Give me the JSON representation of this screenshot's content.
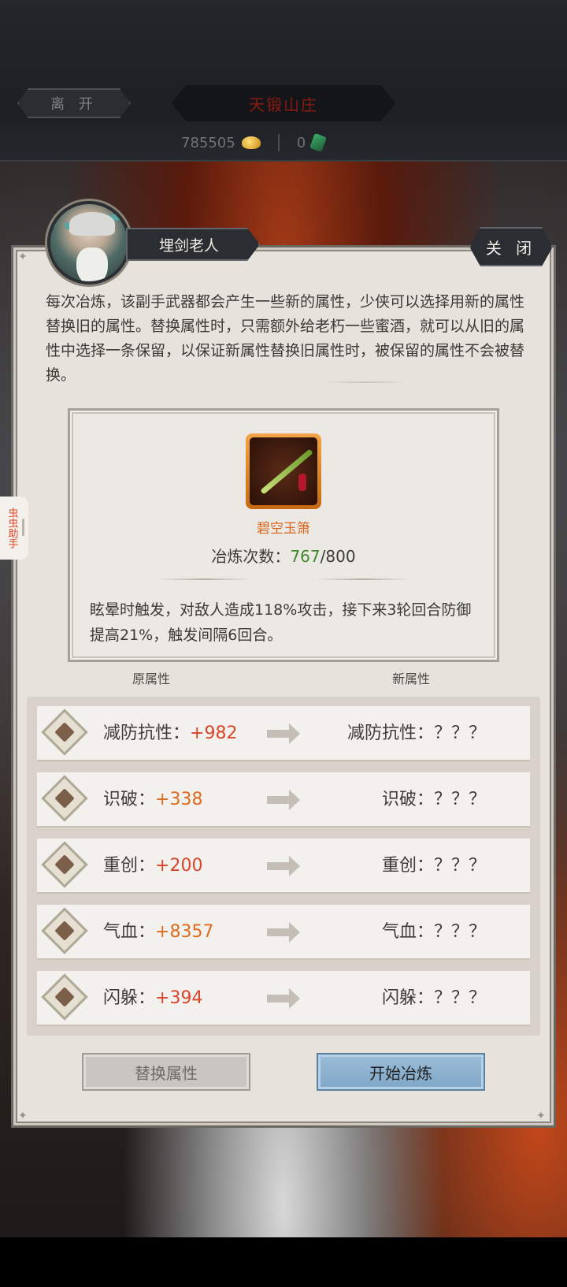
{
  "header": {
    "leave_label": "离 开",
    "location": "天锻山庄",
    "gold_amount": "785505",
    "jade_amount": "0"
  },
  "helper": {
    "label": "虫虫助手"
  },
  "dialog": {
    "npc_name": "埋剑老人",
    "close_label": "关 闭",
    "description": "每次冶炼，该副手武器都会产生一些新的属性，少侠可以选择用新的属性替换旧的属性。替换属性时，只需额外给老朽一些蜜酒，就可以从旧的属性中选择一条保留，以保证新属性替换旧属性时，被保留的属性不会被替换。"
  },
  "item": {
    "name": "碧空玉箫",
    "refine_label": "冶炼次数：",
    "refine_current": "767",
    "refine_max": "/800",
    "effect": "眩晕时触发，对敌人造成118%攻击，接下来3轮回合防御提高21%，触发间隔6回合。"
  },
  "columns": {
    "old_label": "原属性",
    "new_label": "新属性"
  },
  "attributes": [
    {
      "name": "减防抗性：",
      "value": "+982",
      "new": "减防抗性：？？？",
      "value_color": "#d9442a"
    },
    {
      "name": "识破：",
      "value": "+338",
      "new": "识破：？？？",
      "value_color": "#de6a1e"
    },
    {
      "name": "重创：",
      "value": "+200",
      "new": "重创：？？？",
      "value_color": "#d9442a"
    },
    {
      "name": "气血：",
      "value": "+8357",
      "new": "气血：？？？",
      "value_color": "#de6a1e"
    },
    {
      "name": "闪躲：",
      "value": "+394",
      "new": "闪躲：？？？",
      "value_color": "#d9442a"
    }
  ],
  "buttons": {
    "replace_label": "替换属性",
    "start_label": "开始冶炼"
  }
}
